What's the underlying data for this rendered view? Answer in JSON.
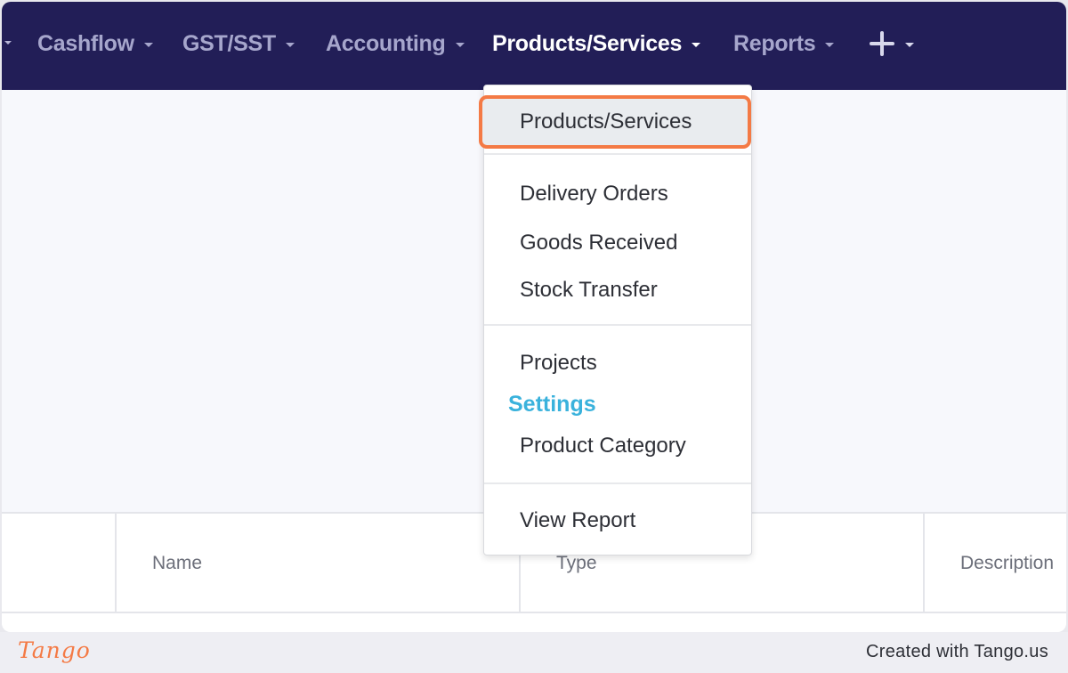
{
  "navbar": {
    "items": [
      {
        "label": "Cashflow"
      },
      {
        "label": "GST/SST"
      },
      {
        "label": "Accounting"
      },
      {
        "label": "Products/Services",
        "active": true
      },
      {
        "label": "Reports"
      }
    ],
    "add_icon": "plus-icon"
  },
  "dropdown": {
    "items": [
      {
        "label": "Products/Services",
        "highlighted": true
      },
      {
        "label": "Delivery Orders"
      },
      {
        "label": "Goods Received"
      },
      {
        "label": "Stock Transfer"
      },
      {
        "label": "Projects"
      },
      {
        "label": "Product Category"
      },
      {
        "label": "View Report"
      }
    ],
    "settings_header": "Settings"
  },
  "table": {
    "columns": [
      "Name",
      "Type",
      "Description"
    ]
  },
  "footer": {
    "logo": "Tango",
    "credit": "Created with Tango.us"
  },
  "colors": {
    "navbar_bg": "#221e57",
    "highlight_border": "#f47a45",
    "settings_header": "#3ab2dc"
  }
}
